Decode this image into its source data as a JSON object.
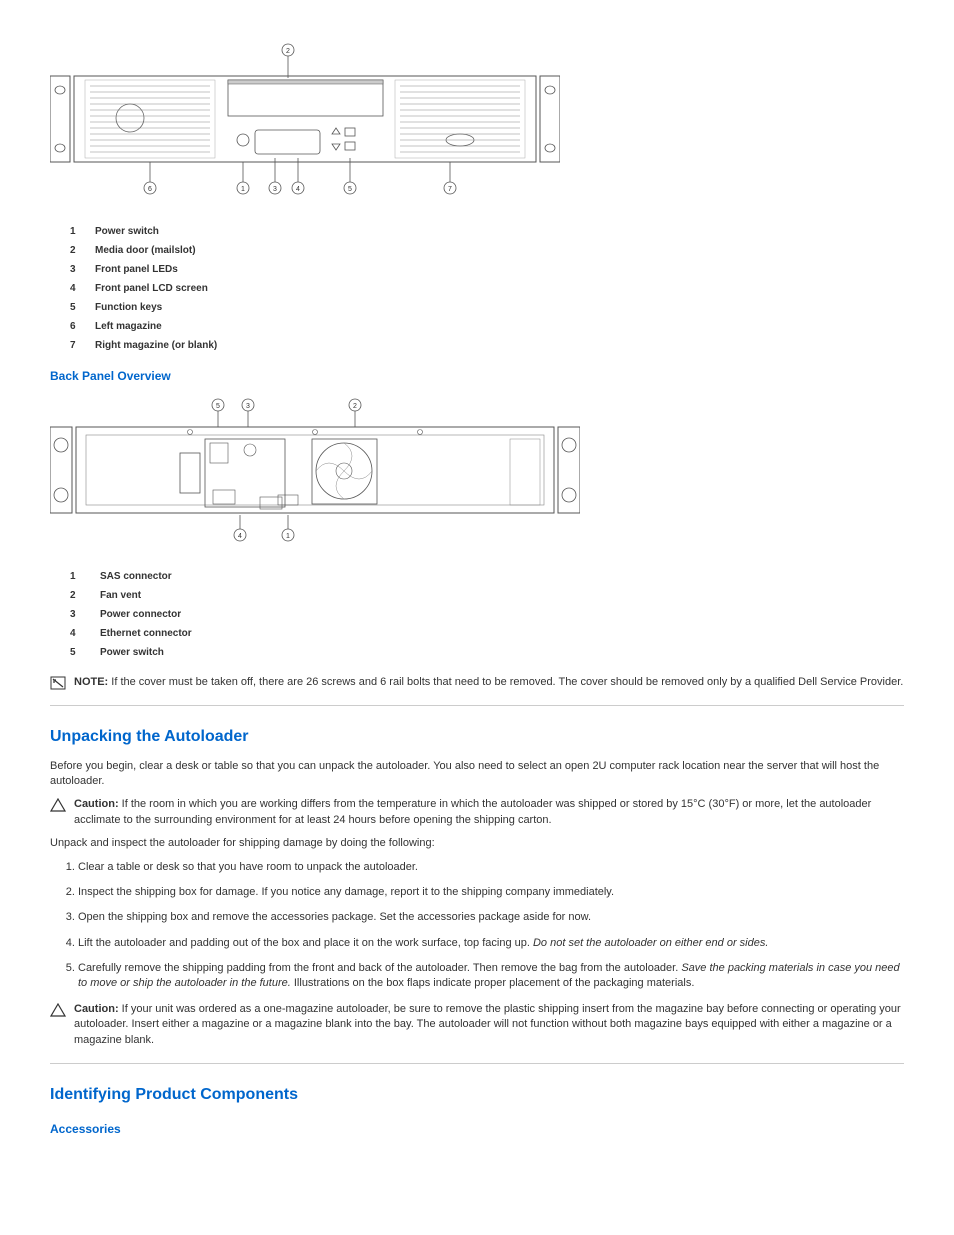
{
  "frontPanel": {
    "legend": [
      {
        "num": "1",
        "label": "Power switch"
      },
      {
        "num": "2",
        "label": "Media door (mailslot)"
      },
      {
        "num": "3",
        "label": "Front panel LEDs"
      },
      {
        "num": "4",
        "label": "Front panel LCD screen"
      },
      {
        "num": "5",
        "label": "Function keys"
      },
      {
        "num": "6",
        "label": "Left magazine"
      },
      {
        "num": "7",
        "label": "Right magazine (or blank)"
      }
    ]
  },
  "backPanel": {
    "heading": "Back Panel Overview",
    "legend": [
      {
        "num": "1",
        "label": "SAS connector"
      },
      {
        "num": "2",
        "label": "Fan vent"
      },
      {
        "num": "3",
        "label": "Power connector"
      },
      {
        "num": "4",
        "label": "Ethernet connector"
      },
      {
        "num": "5",
        "label": "Power switch"
      }
    ]
  },
  "note1": {
    "label": "NOTE:",
    "text": " If the cover must be taken off, there are 26 screws and 6 rail bolts that need to be removed. The cover should be removed only by a qualified Dell Service Provider."
  },
  "unpacking": {
    "heading": "Unpacking the Autoloader",
    "intro": "Before you begin, clear a desk or table so that you can unpack the autoloader. You also need to select an open 2U computer rack location near the server that will host the autoloader.",
    "caution1": {
      "label": "Caution:",
      "text": " If the room in which you are working differs from the temperature in which the autoloader was shipped or stored by 15°C (30°F) or more, let the autoloader acclimate to the surrounding environment for at least 24 hours before opening the shipping carton."
    },
    "inspect": "Unpack and inspect the autoloader for shipping damage by doing the following:",
    "steps": [
      {
        "text": "Clear a table or desk so that you have room to unpack the autoloader."
      },
      {
        "text": "Inspect the shipping box for damage. If you notice any damage, report it to the shipping company immediately."
      },
      {
        "text": "Open the shipping box and remove the accessories package. Set the accessories package aside for now."
      },
      {
        "text": "Lift the autoloader and padding out of the box and place it on the work surface, top facing up. ",
        "em": "Do not set the autoloader on either end or sides."
      },
      {
        "text": "Carefully remove the shipping padding from the front and back of the autoloader. Then remove the bag from the autoloader. ",
        "em": "Save the packing materials in case you need to move or ship the autoloader in the future.",
        "after": " Illustrations on the box flaps indicate proper placement of the packaging materials."
      }
    ],
    "caution2": {
      "label": "Caution:",
      "text": " If your unit was ordered as a one-magazine autoloader, be sure to remove the plastic shipping insert from the magazine bay before connecting or operating your autoloader. Insert either a magazine or a magazine blank into the bay. The autoloader will not function without both magazine bays equipped with either a magazine or a magazine blank."
    }
  },
  "identifying": {
    "heading": "Identifying Product Components",
    "accessories": "Accessories"
  }
}
